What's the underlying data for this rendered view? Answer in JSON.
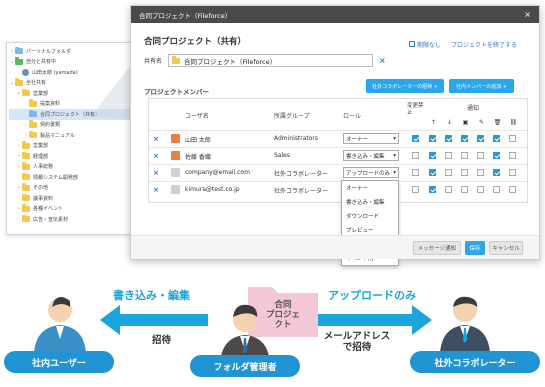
{
  "tree": {
    "items": [
      {
        "label": "パーソナルフォルダ",
        "indent": 0,
        "icon": "folder-blue",
        "caret": ">"
      },
      {
        "label": "自分と共有中",
        "indent": 0,
        "icon": "folder-green",
        "caret": "v"
      },
      {
        "label": "山田太郎 (yamada)",
        "indent": 1,
        "icon": "user",
        "caret": ""
      },
      {
        "label": "全社共有",
        "indent": 0,
        "icon": "folder",
        "caret": "v"
      },
      {
        "label": "営業部",
        "indent": 1,
        "icon": "folder",
        "caret": "v"
      },
      {
        "label": "提案資料",
        "indent": 2,
        "icon": "folder",
        "caret": ""
      },
      {
        "label": "合同プロジェクト（共有）",
        "indent": 2,
        "icon": "folder-blue",
        "caret": "",
        "selected": true
      },
      {
        "label": "契約書類",
        "indent": 2,
        "icon": "folder",
        "caret": ">"
      },
      {
        "label": "製品マニュアル",
        "indent": 2,
        "icon": "folder",
        "caret": ">"
      },
      {
        "label": "営業部",
        "indent": 1,
        "icon": "folder",
        "caret": ">"
      },
      {
        "label": "経理部",
        "indent": 1,
        "icon": "folder",
        "caret": ">"
      },
      {
        "label": "人事総務",
        "indent": 1,
        "icon": "folder",
        "caret": ">"
      },
      {
        "label": "情報システム開発部",
        "indent": 1,
        "icon": "folder",
        "caret": ""
      },
      {
        "label": "その他",
        "indent": 1,
        "icon": "folder",
        "caret": ">"
      },
      {
        "label": "議事資料",
        "indent": 1,
        "icon": "folder",
        "caret": ""
      },
      {
        "label": "各種イベント",
        "indent": 1,
        "icon": "folder",
        "caret": ">"
      },
      {
        "label": "広告・宣伝素材",
        "indent": 1,
        "icon": "folder",
        "caret": ""
      }
    ]
  },
  "dialog": {
    "title": "合同プロジェクト（Fileforce）",
    "close": "×",
    "heading": "合同プロジェクト（共有）",
    "expiry_link": "期限なし",
    "end_link": "プロジェクトを終了する",
    "name_label": "共有名",
    "name_value": "合同プロジェクト（Fileforce）",
    "clear": "×",
    "members_label": "プロジェクトメンバー",
    "invite_external": "社外コラボレーターの招待 +",
    "add_internal": "社内メンバーの追加 +",
    "columns": {
      "user": "ユーザ名",
      "group": "所属グループ",
      "role": "ロール",
      "change_ban": "変更禁止",
      "notify": "通知"
    },
    "notify_icons": [
      "↑",
      "↓",
      "▣",
      "✎",
      "🗑",
      "⛓"
    ],
    "rows": [
      {
        "avatar_color": "#e8813a",
        "name": "山田 太郎",
        "group": "Administrators",
        "role": "オーナー",
        "checks": [
          true,
          true,
          true,
          true,
          true,
          true,
          false
        ]
      },
      {
        "avatar_color": "#e8813a",
        "name": "佐藤 香織",
        "group": "Sales",
        "role": "書き込み・編集",
        "checks": [
          false,
          true,
          false,
          false,
          false,
          true,
          false
        ]
      },
      {
        "avatar_color": "#d0d0d0",
        "name": "company@email.com",
        "group": "社外コラボレーター",
        "role": "アップロードのみ",
        "checks": [
          false,
          true,
          false,
          false,
          false,
          true,
          false
        ]
      },
      {
        "avatar_color": "#d0d0d0",
        "name": "kimura@test.co.jp",
        "group": "社外コラボレーター",
        "role": "",
        "checks": [
          false,
          true,
          false,
          false,
          false,
          false,
          false
        ]
      }
    ],
    "dropdown": [
      "オーナー",
      "書き込み・編集",
      "ダウンロード",
      "プレビュー",
      "アップロードのみ",
      "イベント用"
    ],
    "dropdown_active": 4,
    "footer": {
      "message": "メッセージ通知",
      "save": "保存",
      "cancel": "キャンセル"
    }
  },
  "illustration": {
    "left_pill": "社内ユーザー",
    "center_pill": "フォルダ管理者",
    "right_pill": "社外コラボレーター",
    "folder_text": "合同\nプロジェクト",
    "left_arrow_label": "書き込み・編集",
    "right_arrow_label": "アップロードのみ",
    "invite_left": "招待",
    "invite_right": "メールアドレス\nで招待",
    "colors": {
      "accent": "#1ba5dd",
      "pill": "#2195d3",
      "folder": "#f3c7d6"
    }
  }
}
